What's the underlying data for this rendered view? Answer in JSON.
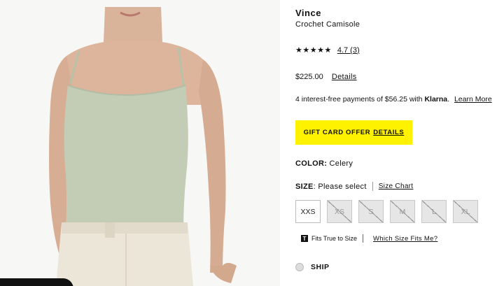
{
  "product": {
    "brand": "Vince",
    "name": "Crochet Camisole",
    "stars": "★★★★★",
    "rating_text": "4.7 (3)",
    "price": "$225.00",
    "price_details_link": "Details"
  },
  "klarna": {
    "text": "4 interest-free payments of $56.25 with",
    "brand": "Klarna",
    "period": ".",
    "learn_more": "Learn More"
  },
  "gift_offer": {
    "label": "GIFT CARD OFFER",
    "details": "DETAILS",
    "color": "#fff200"
  },
  "color_option": {
    "label": "COLOR:",
    "value": "Celery"
  },
  "size_option": {
    "label": "SIZE",
    "colon_text": ": Please select",
    "size_chart": "Size Chart",
    "sizes": [
      {
        "label": "XXS",
        "available": true
      },
      {
        "label": "XS",
        "available": false
      },
      {
        "label": "S",
        "available": false
      },
      {
        "label": "M",
        "available": false
      },
      {
        "label": "L",
        "available": false
      },
      {
        "label": "XL",
        "available": false
      }
    ]
  },
  "fit": {
    "badge": "T",
    "text": "Fits True to Size",
    "which_size": "Which Size Fits Me?"
  },
  "shipping": {
    "label": "SHIP"
  },
  "image": {
    "subject": "model wearing celery crochet camisole",
    "top_color": "#c3cdb6",
    "skin_color": "#d9b39a"
  }
}
